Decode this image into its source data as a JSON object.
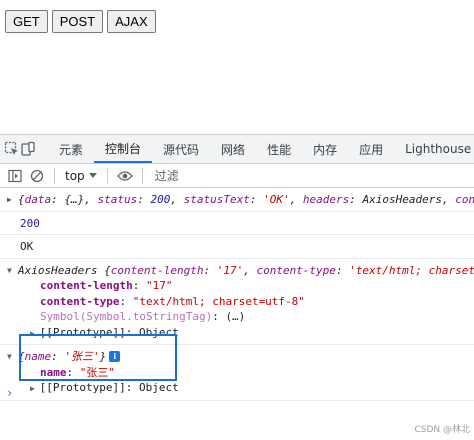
{
  "page": {
    "buttons": [
      "GET",
      "POST",
      "AJAX"
    ]
  },
  "devtools": {
    "tabs": [
      "元素",
      "控制台",
      "源代码",
      "网络",
      "性能",
      "内存",
      "应用",
      "Lighthouse"
    ],
    "active_tab": "控制台",
    "toolbar": {
      "context": "top",
      "filter_placeholder": "过滤"
    },
    "console": {
      "line1": {
        "open": "{",
        "data_key": "data",
        "data_val": "{…}",
        "status_key": "status",
        "status_val": "200",
        "statusText_key": "statusText",
        "statusText_val": "'OK'",
        "headers_key": "headers",
        "headers_val": "AxiosHeaders",
        "trail": "con"
      },
      "line2": "200",
      "line3": "OK",
      "headers_obj": {
        "class_name": "AxiosHeaders",
        "preview_open": "{",
        "cl_key": "content-length",
        "cl_preview": "'17'",
        "ct_key": "content-type",
        "ct_preview": "'text/html; charset=",
        "rows": [
          {
            "key": "content-length",
            "value": "\"17\""
          },
          {
            "key": "content-type",
            "value": "\"text/html; charset=utf-8\""
          }
        ],
        "symbol_key": "Symbol(Symbol.toStringTag)",
        "symbol_val": "(…)",
        "proto_key": "[[Prototype]]",
        "proto_val": "Object"
      },
      "name_obj": {
        "preview_open": "{",
        "key": "name",
        "preview_val": "'张三'",
        "preview_close": "}",
        "info_icon": "i",
        "row_key": "name",
        "row_val": "\"张三\"",
        "proto_key": "[[Prototype]]",
        "proto_val": "Object"
      }
    },
    "prompt_symbol": "›"
  },
  "watermark": "CSDN @林北",
  "colors": {
    "accent": "#1a73e8",
    "highlight_box": "#1a6fd1",
    "key": "#881280",
    "string": "#c80000",
    "number": "#1a1aa6"
  }
}
